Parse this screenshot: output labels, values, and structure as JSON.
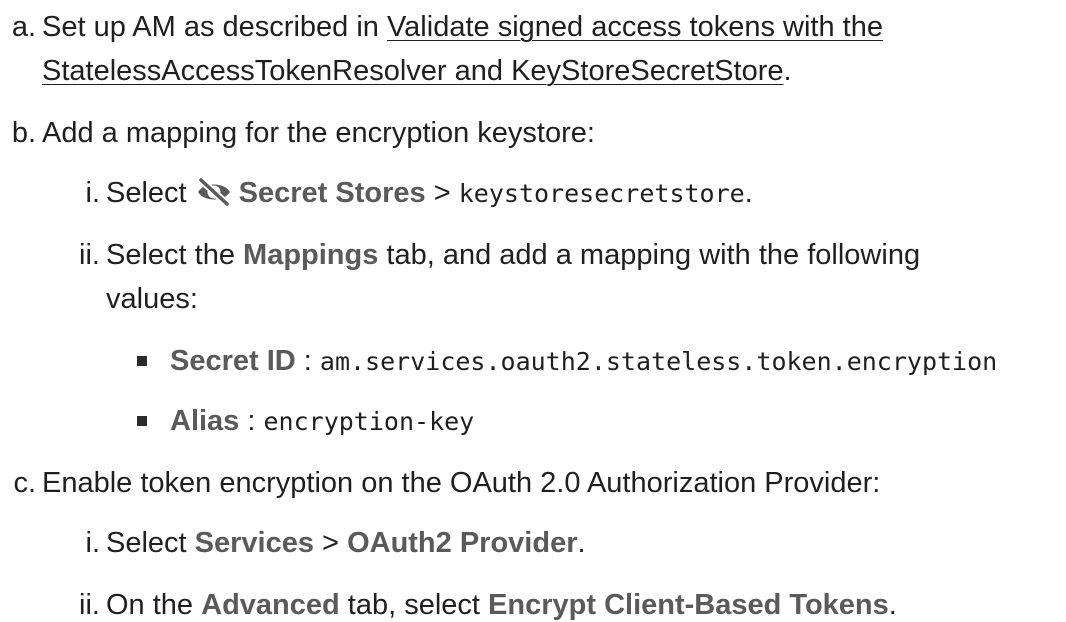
{
  "steps": {
    "a": {
      "marker": "a.",
      "text_1": "Set up AM as described in ",
      "link_line_1": "Validate signed access tokens with the",
      "link_line_2": "StatelessAccessTokenResolver and KeyStoreSecretStore",
      "end": "."
    },
    "b": {
      "marker": "b.",
      "text": "Add a mapping for the encryption keystore:",
      "sub_i": {
        "marker": "i.",
        "text_1": "Select ",
        "icon": "eye-slash-icon",
        "ui_1": "Secret Stores",
        "sep": " > ",
        "code": "keystoresecretstore",
        "end": "."
      },
      "sub_ii": {
        "marker": "ii.",
        "text_1": "Select the ",
        "ui_1": "Mappings",
        "text_2": " tab, and add a mapping with the following",
        "line_2": "values:",
        "bullets": [
          {
            "label": "Secret ID",
            "sep": " : ",
            "code": "am.services.oauth2.stateless.token.encryption"
          },
          {
            "label": "Alias",
            "sep": " : ",
            "code": "encryption-key"
          }
        ]
      }
    },
    "c": {
      "marker": "c.",
      "text": "Enable token encryption on the OAuth 2.0 Authorization Provider:",
      "sub_i": {
        "marker": "i.",
        "text_1": "Select ",
        "ui_1": "Services",
        "sep": " > ",
        "ui_2": "OAuth2 Provider",
        "end": "."
      },
      "sub_ii": {
        "marker": "ii.",
        "text_1": "On the ",
        "ui_1": "Advanced",
        "text_2": " tab, select ",
        "ui_2": "Encrypt Client-Based Tokens",
        "end": "."
      }
    }
  }
}
